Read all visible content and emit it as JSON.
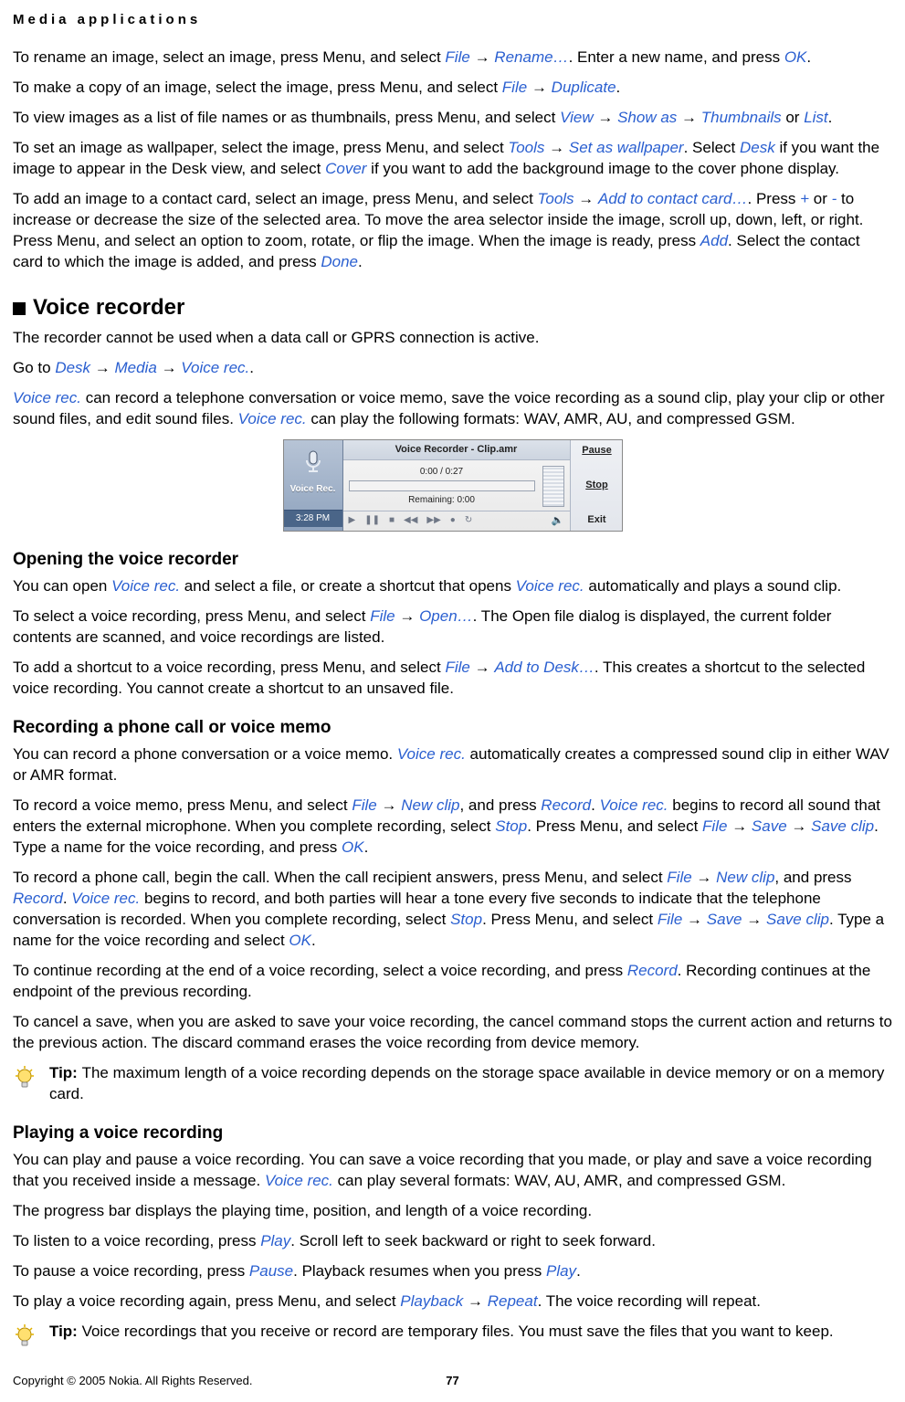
{
  "running_head": "Media applications",
  "arrow": "→",
  "p1": {
    "a": "To rename an image, select an image, press Menu, and select ",
    "file": "File",
    "rename": "Rename…",
    "b": ". Enter a new name, and press ",
    "ok": "OK",
    "c": "."
  },
  "p2": {
    "a": "To make a copy of an image, select the image, press Menu, and select ",
    "file": "File",
    "dup": "Duplicate",
    "b": "."
  },
  "p3": {
    "a": "To view images as a list of file names or as thumbnails, press Menu, and select ",
    "view": "View",
    "showas": "Show as",
    "thumbs": "Thumbnails",
    "or": " or ",
    "list": "List",
    "b": "."
  },
  "p4": {
    "a": "To set an image as wallpaper, select the image, press Menu, and select ",
    "tools": "Tools",
    "setwp": "Set as wallpaper",
    "b": ". Select ",
    "desk": "Desk",
    "c": " if you want the image to appear in the Desk view, and select ",
    "cover": "Cover",
    "d": " if you want to add the background image to the cover phone display."
  },
  "p5": {
    "a": "To add an image to a contact card, select an image, press Menu, and select ",
    "tools": "Tools",
    "addcc": "Add to contact card…",
    "b": ". Press ",
    "plus": "+",
    "c": " or ",
    "minus": "-",
    "d": " to increase or decrease the size of the selected area. To move the area selector inside the image, scroll up, down, left, or right. Press Menu, and select an option to zoom, rotate, or flip the image. When the image is ready, press ",
    "add": "Add",
    "e": ". Select the contact card to which the image is added, and press ",
    "done": "Done",
    "f": "."
  },
  "sec_voice": "Voice recorder",
  "p6": "The recorder cannot be used when a data call or GPRS connection is active.",
  "p7": {
    "a": "Go to ",
    "desk": "Desk",
    "media": "Media",
    "vr": "Voice rec.",
    "b": "."
  },
  "p8": {
    "vr": "Voice rec.",
    "a": " can record a telephone conversation or voice memo, save the voice recording as a sound clip, play your clip or other sound files, and edit sound files. ",
    "vr2": "Voice rec.",
    "b": " can play the following formats: WAV, AMR, AU, and compressed GSM."
  },
  "fig": {
    "left_label": "Voice Rec.",
    "clock": "3:28 PM",
    "title": "Voice Recorder - Clip.amr",
    "time": "0:00 / 0:27",
    "remaining": "Remaining: 0:00",
    "btn_pause": "Pause",
    "btn_stop": "Stop",
    "btn_exit": "Exit"
  },
  "sub_open": "Opening the voice recorder",
  "p9": {
    "a": "You can open ",
    "vr": "Voice rec.",
    "b": " and select a file, or create a shortcut that opens ",
    "vr2": "Voice rec.",
    "c": " automatically and plays a sound clip."
  },
  "p10": {
    "a": "To select a voice recording, press Menu, and select ",
    "file": "File",
    "open": "Open…",
    "b": ". The Open file dialog is displayed, the current folder contents are scanned, and voice recordings are listed."
  },
  "p11": {
    "a": "To add a shortcut to a voice recording, press Menu, and select ",
    "file": "File",
    "adddesk": "Add to Desk…",
    "b": ". This creates a shortcut to the selected voice recording. You cannot create a shortcut to an unsaved file."
  },
  "sub_rec": "Recording a phone call or voice memo",
  "p12": {
    "a": "You can record a phone conversation or a voice memo. ",
    "vr": "Voice rec.",
    "b": " automatically creates a compressed sound clip in either WAV or AMR format."
  },
  "p13": {
    "a": "To record a voice memo, press Menu, and select ",
    "file": "File",
    "newclip": "New clip",
    "b": ", and press ",
    "record": "Record",
    "c": ". ",
    "vr": "Voice rec.",
    "d": " begins to record all sound that enters the external microphone. When you complete recording, select ",
    "stop": "Stop",
    "e": ". Press Menu, and select ",
    "file2": "File",
    "save": "Save",
    "saveclip": "Save clip",
    "f": ". Type a name for the voice recording, and press ",
    "ok": "OK",
    "g": "."
  },
  "p14": {
    "a": "To record a phone call, begin the call. When the call recipient answers, press Menu, and select ",
    "file": "File",
    "newclip": "New clip",
    "b": ", and press ",
    "record": "Record",
    "c": ". ",
    "vr": "Voice rec.",
    "d": " begins to record, and both parties will hear a tone every five seconds to indicate that the telephone conversation is recorded. When you complete recording, select ",
    "stop": "Stop",
    "e": ". Press Menu, and select ",
    "file2": "File",
    "save": "Save",
    "saveclip": "Save clip",
    "f": ". Type a name for the voice recording and select ",
    "ok": "OK",
    "g": "."
  },
  "p15": {
    "a": "To continue recording at the end of a voice recording, select a voice recording, and press ",
    "record": "Record",
    "b": ". Recording continues at the endpoint of the previous recording."
  },
  "p16": "To cancel a save, when you are asked to save your voice recording, the cancel command stops the current action and returns to the previous action. The discard command erases the voice recording from device memory.",
  "tip1": {
    "label": "Tip: ",
    "body": "The maximum length of a voice recording depends on the storage space available in device memory or on a memory card."
  },
  "sub_play": "Playing a voice recording",
  "p17": {
    "a": "You can play and pause a voice recording. You can save a voice recording that you made, or play and save a voice recording that you received inside a message. ",
    "vr": "Voice rec.",
    "b": " can play several formats: WAV, AU, AMR, and compressed GSM."
  },
  "p18": "The progress bar displays the playing time, position, and length of a voice recording.",
  "p19": {
    "a": "To listen to a voice recording, press ",
    "play": "Play",
    "b": ". Scroll left to seek backward or right to seek forward."
  },
  "p20": {
    "a": "To pause a voice recording, press ",
    "pause": "Pause",
    "b": ". Playback resumes when you press ",
    "play": "Play",
    "c": "."
  },
  "p21": {
    "a": "To play a voice recording again, press Menu, and select ",
    "playback": "Playback",
    "repeat": "Repeat",
    "b": ". The voice recording will repeat."
  },
  "tip2": {
    "label": "Tip: ",
    "body": "Voice recordings that you receive or record are temporary files. You must save the files that you want to keep."
  },
  "footer": {
    "copyright": "Copyright © 2005 Nokia. All Rights Reserved.",
    "page": "77"
  }
}
